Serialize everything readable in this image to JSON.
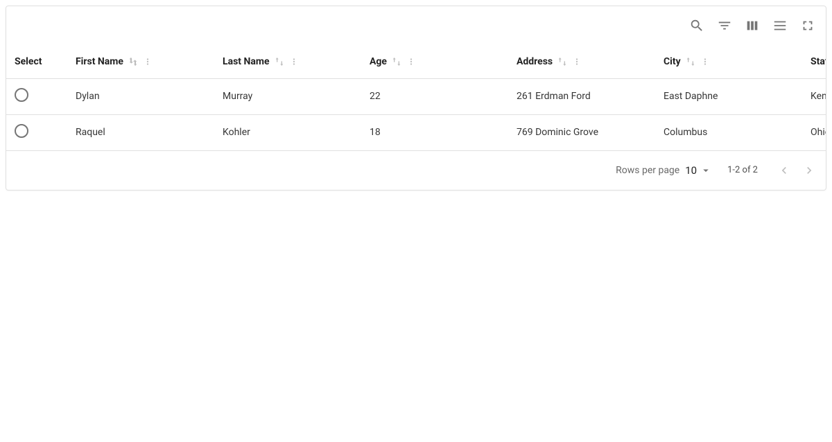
{
  "toolbar": {
    "icons": [
      "search",
      "filter",
      "columns",
      "density",
      "fullscreen"
    ]
  },
  "columns": {
    "select": "Select",
    "firstName": "First Name",
    "lastName": "Last Name",
    "age": "Age",
    "address": "Address",
    "city": "City",
    "state": "State"
  },
  "rows": [
    {
      "firstName": "Dylan",
      "lastName": "Murray",
      "age": "22",
      "address": "261 Erdman Ford",
      "city": "East Daphne",
      "state": "Kentucky"
    },
    {
      "firstName": "Raquel",
      "lastName": "Kohler",
      "age": "18",
      "address": "769 Dominic Grove",
      "city": "Columbus",
      "state": "Ohio"
    }
  ],
  "pagination": {
    "rowsPerPageLabel": "Rows per page",
    "rowsPerPageValue": "10",
    "rangeLabel": "1-2 of 2"
  }
}
